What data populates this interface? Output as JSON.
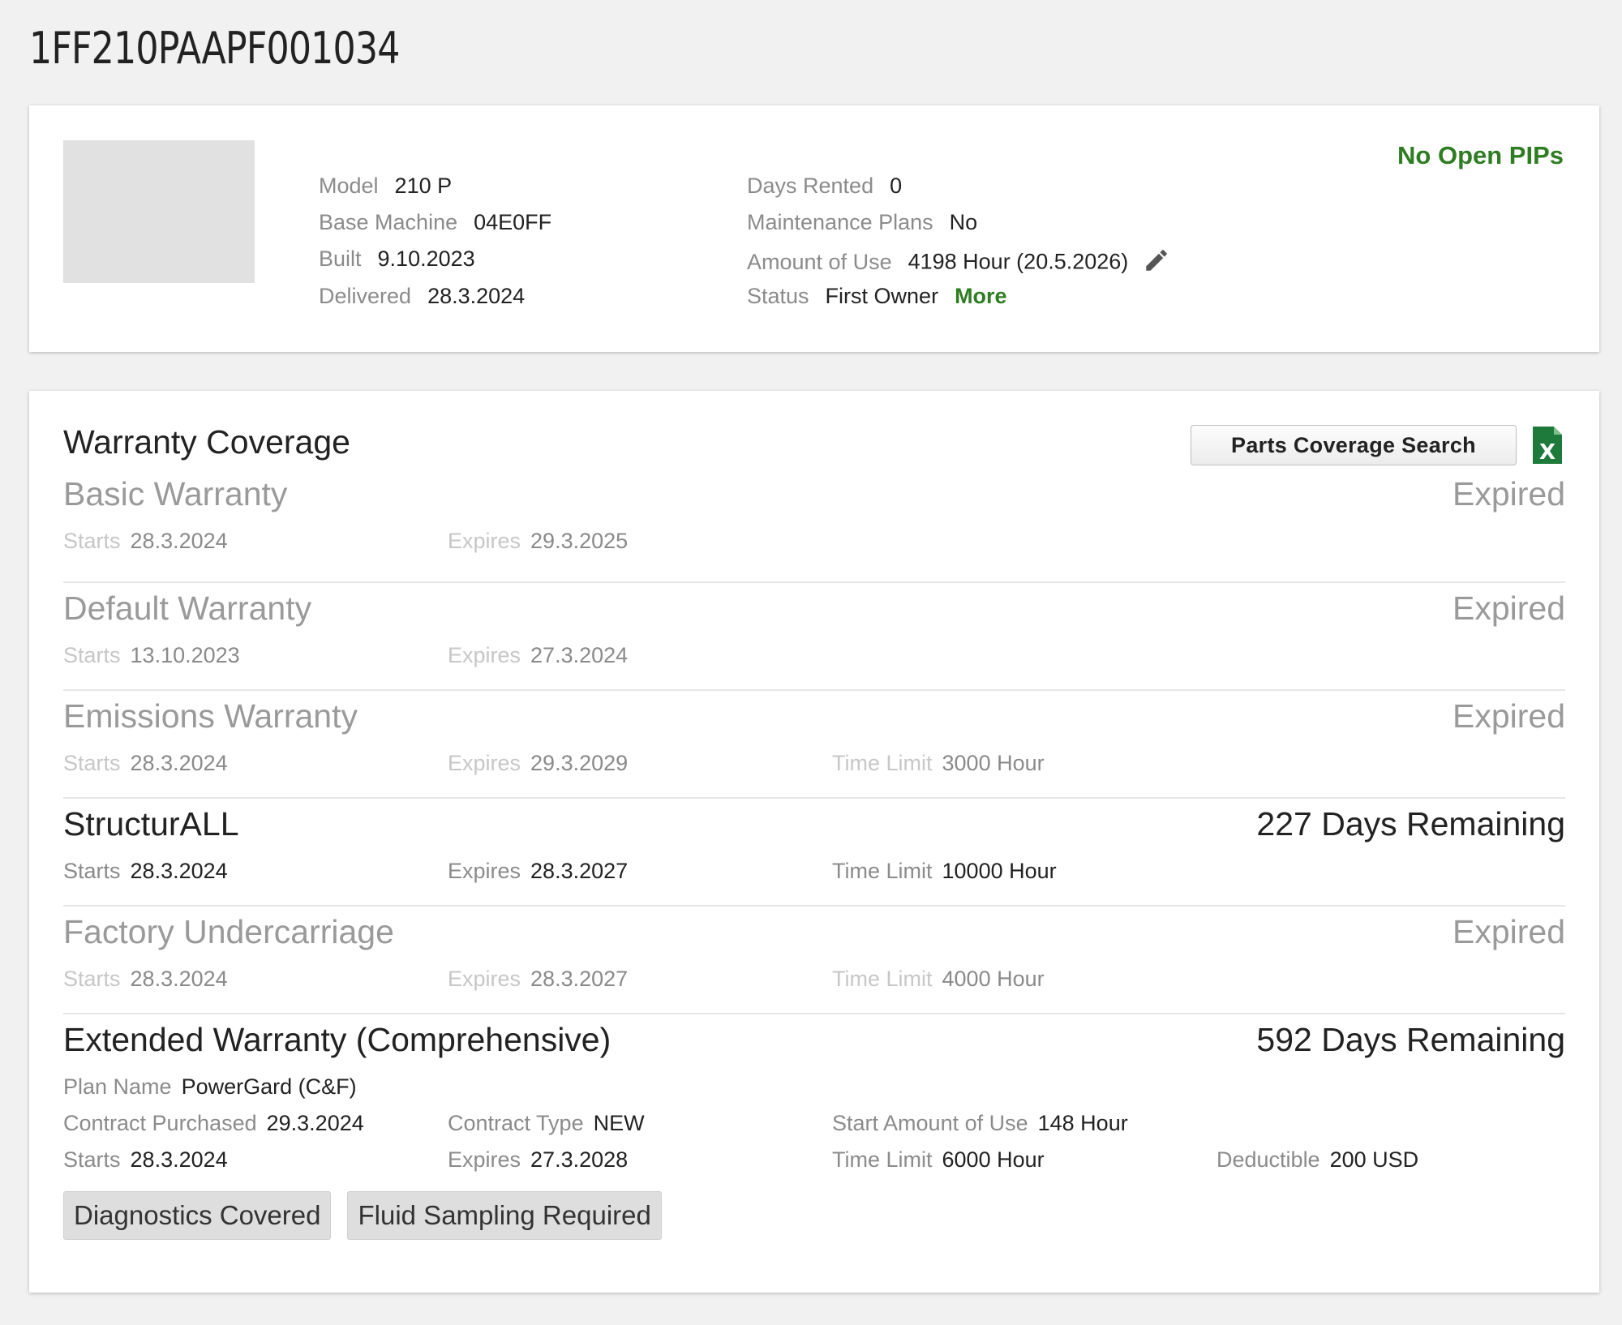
{
  "page": {
    "title": "1FF210PAAPF001034"
  },
  "machine": {
    "specs_left": [
      {
        "label": "Model",
        "value": "210 P"
      },
      {
        "label": "Base Machine",
        "value": "04E0FF"
      },
      {
        "label": "Built",
        "value": "9.10.2023"
      },
      {
        "label": "Delivered",
        "value": "28.3.2024"
      }
    ],
    "specs_right": [
      {
        "label": "Days Rented",
        "value": "0"
      },
      {
        "label": "Maintenance Plans",
        "value": "No"
      },
      {
        "label": "Amount of Use",
        "value": "4198 Hour (20.5.2026)"
      },
      {
        "label": "Status",
        "value": "First Owner",
        "link": "More"
      }
    ],
    "pip_status": "No Open PIPs",
    "pip_color": "#2f7d22"
  },
  "warranty": {
    "title": "Warranty Coverage",
    "parts_button": "Parts Coverage Search",
    "export_icon": "excel-export-icon",
    "items": [
      {
        "name": "Basic Warranty",
        "state": "Expired",
        "starts": {
          "label": "Starts",
          "value": "28.3.2024"
        },
        "expires": {
          "label": "Expires",
          "value": "29.3.2025"
        }
      },
      {
        "name": "Default Warranty",
        "state": "Expired",
        "starts": {
          "label": "Starts",
          "value": "13.10.2023"
        },
        "expires": {
          "label": "Expires",
          "value": "27.3.2024"
        }
      },
      {
        "name": "Emissions Warranty",
        "state": "Expired",
        "starts": {
          "label": "Starts",
          "value": "28.3.2024"
        },
        "expires": {
          "label": "Expires",
          "value": "29.3.2029"
        },
        "time_limit": {
          "label": "Time Limit",
          "value": "3000 Hour"
        }
      },
      {
        "name": "StructurALL",
        "state": "227 Days Remaining",
        "starts": {
          "label": "Starts",
          "value": "28.3.2024"
        },
        "expires": {
          "label": "Expires",
          "value": "28.3.2027"
        },
        "time_limit": {
          "label": "Time Limit",
          "value": "10000 Hour"
        }
      },
      {
        "name": "Factory Undercarriage",
        "state": "Expired",
        "starts": {
          "label": "Starts",
          "value": "28.3.2024"
        },
        "expires": {
          "label": "Expires",
          "value": "28.3.2027"
        },
        "time_limit": {
          "label": "Time Limit",
          "value": "4000 Hour"
        }
      },
      {
        "name": "Extended Warranty (Comprehensive)",
        "state": "592 Days Remaining",
        "plan_name": {
          "label": "Plan Name",
          "value": "PowerGard (C&F)"
        },
        "contract_purchased": {
          "label": "Contract Purchased",
          "value": "29.3.2024"
        },
        "contract_type": {
          "label": "Contract Type",
          "value": "NEW"
        },
        "start_amount": {
          "label": "Start Amount of Use",
          "value": "148 Hour"
        },
        "starts": {
          "label": "Starts",
          "value": "28.3.2024"
        },
        "expires": {
          "label": "Expires",
          "value": "27.3.2028"
        },
        "time_limit": {
          "label": "Time Limit",
          "value": "6000 Hour"
        },
        "deductible": {
          "label": "Deductible",
          "value": "200 USD"
        },
        "badges": [
          "Diagnostics Covered",
          "Fluid Sampling Required"
        ]
      }
    ]
  }
}
